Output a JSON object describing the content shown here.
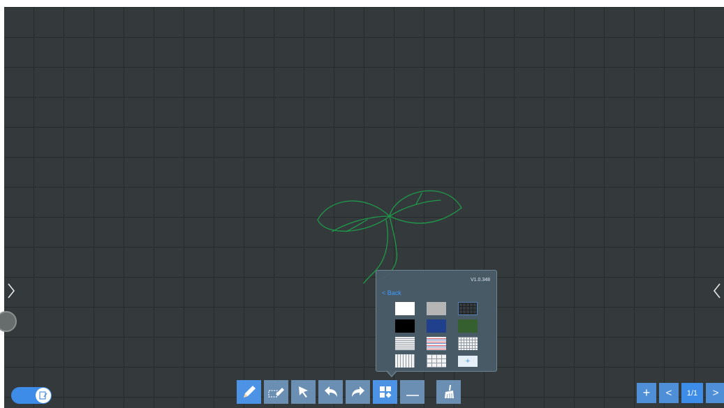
{
  "popup": {
    "version": "V1.0.348",
    "back_label": "< Back",
    "add_label": "+"
  },
  "toolbar": {
    "buttons": [
      "pen",
      "eraser",
      "select",
      "undo",
      "redo",
      "background",
      "line",
      "clear"
    ]
  },
  "page_nav": {
    "add_label": "+",
    "prev_label": "<",
    "page_indicator": "1/1",
    "next_label": ">"
  },
  "colors": {
    "board": "#343a3b",
    "grid_line": "#262b2c",
    "sketch_stroke": "#1e9a4a",
    "accent": "#4c93e6",
    "tool_button": "#6a8fb3",
    "popup_bg": "#495c68",
    "back_link": "#3f9bff"
  },
  "backgrounds": [
    "white",
    "gray",
    "dark-grid",
    "black",
    "navy",
    "green",
    "horizontal-lines",
    "red-blue-lines",
    "small-grid",
    "vertical-lines",
    "large-grid",
    "add-custom"
  ],
  "icons": [
    "chevron-right-icon",
    "chevron-left-icon",
    "pencil-icon",
    "eraser-icon",
    "arrow-pointer-icon",
    "undo-icon",
    "redo-icon",
    "grid-icon",
    "line-icon",
    "broom-icon",
    "plus-icon"
  ]
}
